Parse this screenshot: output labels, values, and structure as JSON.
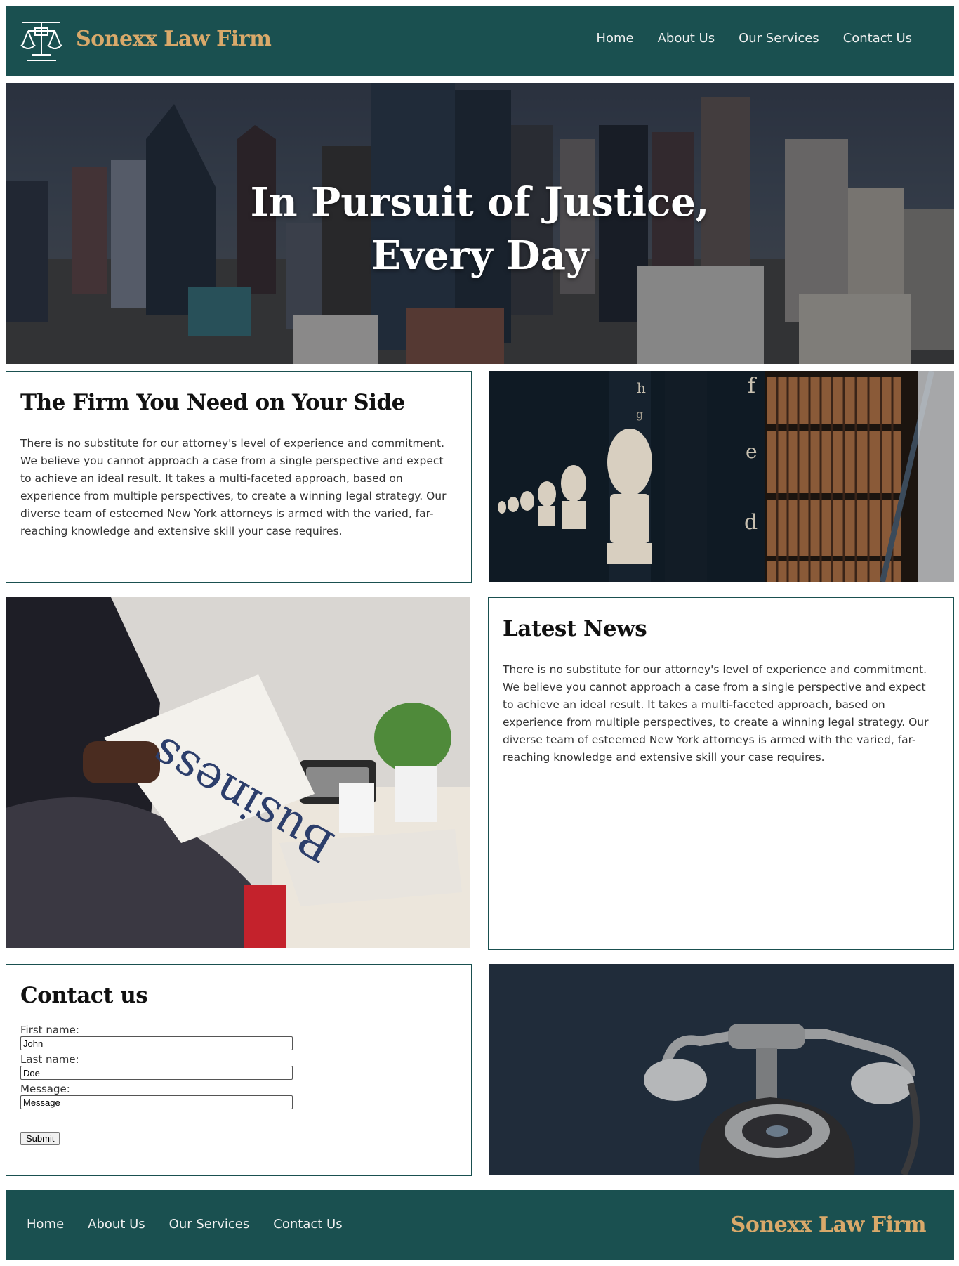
{
  "header": {
    "brand": "Sonexx Law Firm",
    "logo_icon": "scales-of-justice-icon",
    "nav": [
      "Home",
      "About Us",
      "Our Services",
      "Contact Us"
    ]
  },
  "hero": {
    "title_line1": "In Pursuit of Justice,",
    "title_line2": "Every Day"
  },
  "firm": {
    "heading": "The Firm You Need on Your Side",
    "body": "There is no substitute for our attorney's level of experience and commitment. We believe you cannot approach a case from a single perspective and expect to achieve an ideal result. It takes a multi-faceted approach, based on experience from multiple perspectives, to create a winning legal strategy. Our diverse team of esteemed New York attorneys is armed with the varied, far-reaching knowledge and extensive skill your case requires."
  },
  "news": {
    "heading": "Latest News",
    "body": "There is no substitute for our attorney's level of experience and commitment. We believe you cannot approach a case from a single perspective and expect to achieve an ideal result. It takes a multi-faceted approach, based on experience from multiple perspectives, to create a winning legal strategy. Our diverse team of esteemed New York attorneys is armed with the varied, far-reaching knowledge and extensive skill your case requires."
  },
  "library_photo": {
    "shelf_letters": [
      "h",
      "g",
      "f",
      "e",
      "d"
    ]
  },
  "newspaper_photo": {
    "headline": "Business"
  },
  "contact": {
    "heading": "Contact us",
    "first_name_label": "First name:",
    "first_name_value": "John",
    "last_name_label": "Last name:",
    "last_name_value": "Doe",
    "message_label": "Message:",
    "message_value": "Message",
    "submit_label": "Submit"
  },
  "footer": {
    "nav": [
      "Home",
      "About Us",
      "Our Services",
      "Contact Us"
    ],
    "brand": "Sonexx Law Firm"
  },
  "colors": {
    "brand_teal": "#1a5050",
    "brand_gold": "#d9a96a"
  }
}
